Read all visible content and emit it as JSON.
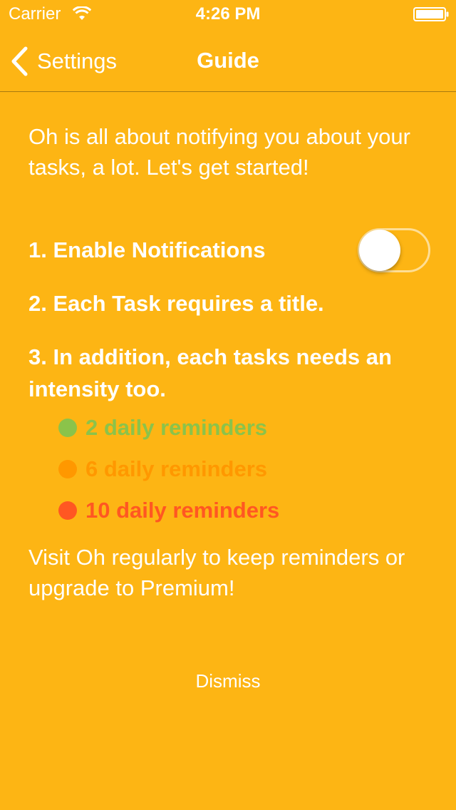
{
  "status_bar": {
    "carrier": "Carrier",
    "time": "4:26 PM",
    "icons": [
      "wifi-icon",
      "battery-icon"
    ]
  },
  "nav": {
    "back_label": "Settings",
    "title": "Guide",
    "back_icon": "chevron-left-icon"
  },
  "content": {
    "intro": "Oh is all about notifying you about your tasks, a lot. Let's get started!",
    "steps": [
      {
        "text": "1. Enable Notifications"
      },
      {
        "text": "2. Each Task requires a title."
      },
      {
        "text": "3. In addition, each tasks needs an intensity too."
      }
    ],
    "notifications_toggle": {
      "on": false
    },
    "intensities": [
      {
        "label": "2 daily reminders",
        "color": "#8BC34A"
      },
      {
        "label": "6 daily reminders",
        "color": "#FF9800"
      },
      {
        "label": "10 daily reminders",
        "color": "#FF5722"
      }
    ],
    "outro": "Visit Oh regularly to keep reminders or upgrade to Premium!",
    "dismiss_label": "Dismiss"
  },
  "colors": {
    "background": "#FDB514",
    "text": "#FFFFFF"
  }
}
